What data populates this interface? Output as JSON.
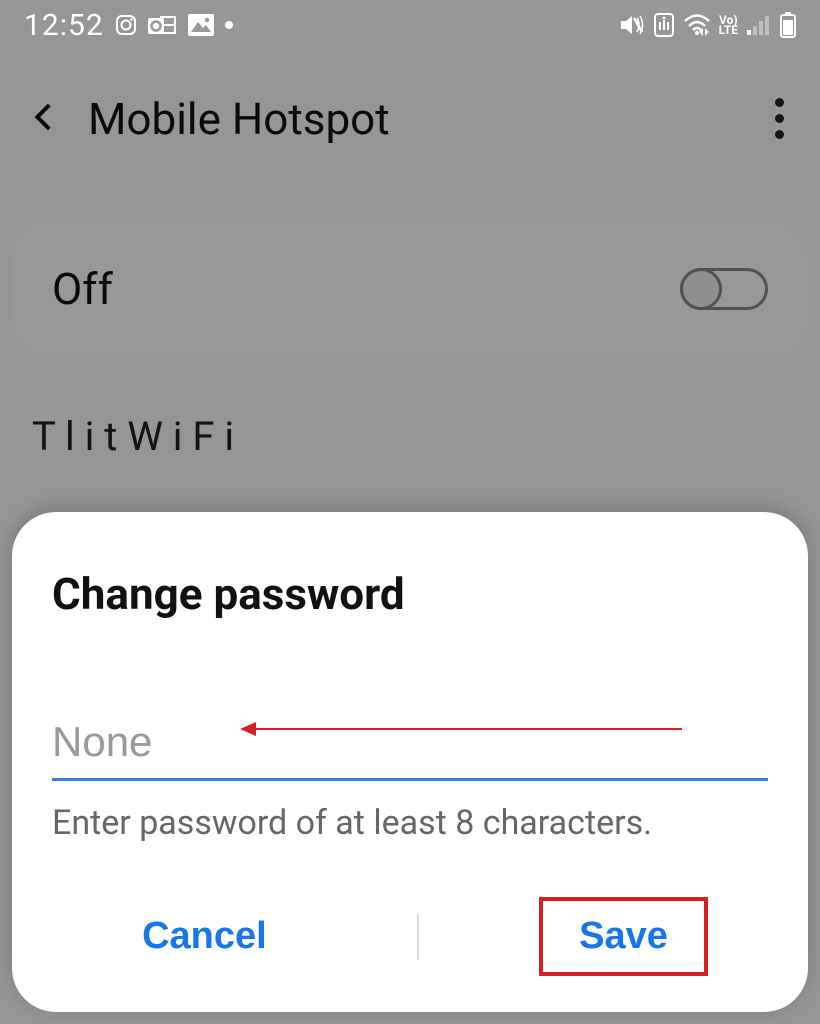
{
  "statusbar": {
    "time": "12:52",
    "indicators": [
      "instagram",
      "outlook",
      "gallery",
      "dot"
    ],
    "right": [
      "mute-vibrate",
      "junk-clean",
      "wifi",
      "volte",
      "signal",
      "battery"
    ]
  },
  "header": {
    "title": "Mobile Hotspot"
  },
  "hotspot_toggle": {
    "label": "Off",
    "on": false
  },
  "bg_hint": "T                    l            i  t            W i  F i",
  "dialog": {
    "title": "Change password",
    "input_placeholder": "None",
    "input_value": "",
    "helper": "Enter password of at least 8 characters.",
    "cancel": "Cancel",
    "save": "Save"
  },
  "annotation": {
    "arrow_target": "password-input",
    "box_target": "save-button"
  },
  "colors": {
    "accent": "#1976e8",
    "underline": "#3a7fe0",
    "annotation": "#d62020"
  }
}
